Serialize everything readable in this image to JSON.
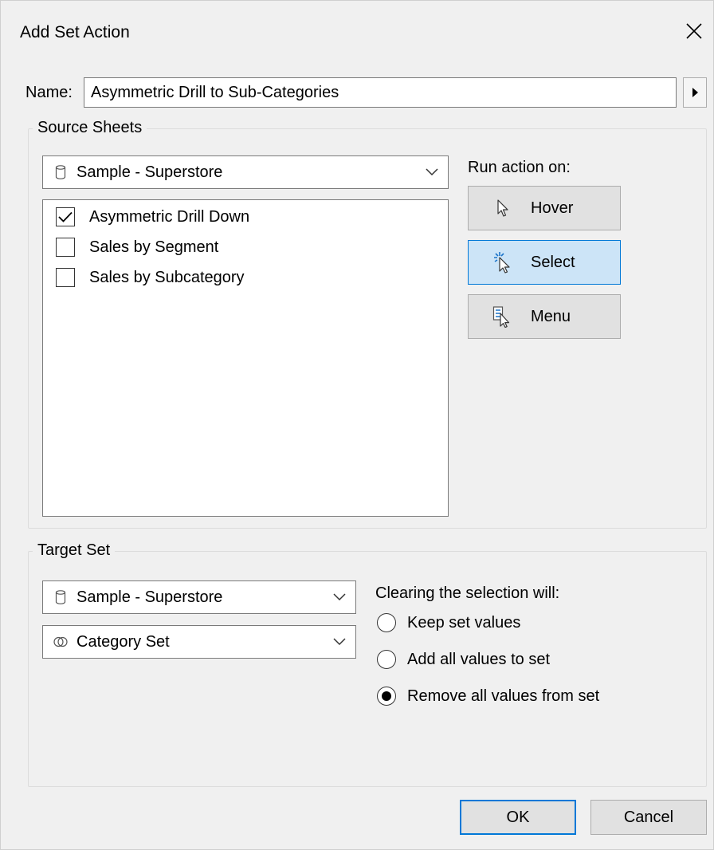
{
  "dialog": {
    "title": "Add Set Action"
  },
  "name_field": {
    "label": "Name:",
    "value": "Asymmetric Drill to Sub-Categories"
  },
  "source_sheets": {
    "title": "Source Sheets",
    "datasource": "Sample - Superstore",
    "sheets": [
      {
        "label": "Asymmetric Drill Down",
        "checked": true
      },
      {
        "label": "Sales by Segment",
        "checked": false
      },
      {
        "label": "Sales by Subcategory",
        "checked": false
      }
    ],
    "run_action_label": "Run action on:",
    "run_options": [
      {
        "label": "Hover",
        "icon": "hover-cursor-icon",
        "active": false
      },
      {
        "label": "Select",
        "icon": "select-cursor-icon",
        "active": true
      },
      {
        "label": "Menu",
        "icon": "menu-cursor-icon",
        "active": false
      }
    ]
  },
  "target_set": {
    "title": "Target Set",
    "datasource": "Sample - Superstore",
    "set": "Category Set",
    "clearing_label": "Clearing the selection will:",
    "options": [
      {
        "label": "Keep set values",
        "selected": false
      },
      {
        "label": "Add all values to set",
        "selected": false
      },
      {
        "label": "Remove all values from set",
        "selected": true
      }
    ]
  },
  "buttons": {
    "ok": "OK",
    "cancel": "Cancel"
  },
  "colors": {
    "selected_bg": "#cce4f7",
    "accent": "#0078d7",
    "button_bg": "#e1e1e1"
  }
}
